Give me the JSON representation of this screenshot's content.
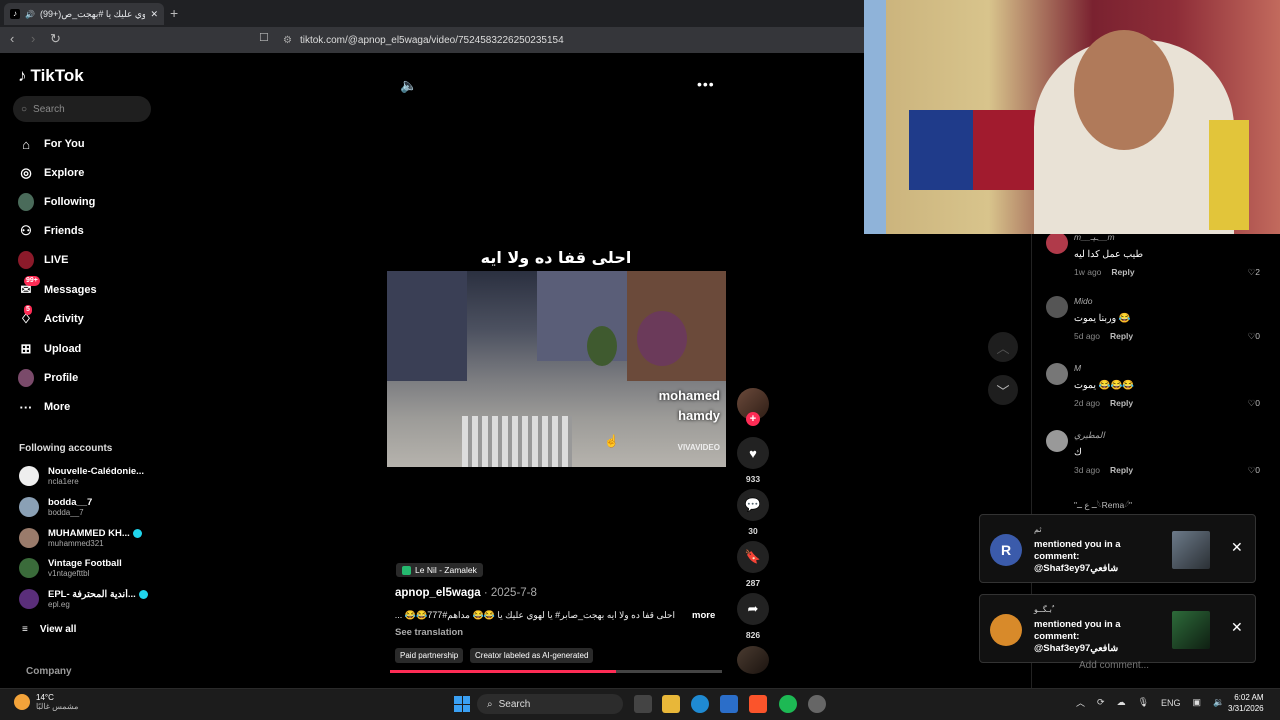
{
  "browser": {
    "tab_title": "(99+)يا لهوي عليك يا #بهجت_ص...",
    "url": "tiktok.com/@apnop_el5waga/video/7524583226250235154"
  },
  "sidebar": {
    "logo": "TikTok",
    "search_placeholder": "Search",
    "nav": [
      {
        "label": "For You",
        "icon": "home-icon"
      },
      {
        "label": "Explore",
        "icon": "compass-icon"
      },
      {
        "label": "Following",
        "icon": "following-avatar-icon"
      },
      {
        "label": "Friends",
        "icon": "friends-icon"
      },
      {
        "label": "LIVE",
        "icon": "live-icon"
      },
      {
        "label": "Messages",
        "icon": "messages-icon",
        "badge": "99+"
      },
      {
        "label": "Activity",
        "icon": "activity-icon",
        "badge": "5"
      },
      {
        "label": "Upload",
        "icon": "upload-icon"
      },
      {
        "label": "Profile",
        "icon": "profile-avatar-icon"
      },
      {
        "label": "More",
        "icon": "more-dots-icon"
      }
    ],
    "following_title": "Following accounts",
    "accounts": [
      {
        "name": "Nouvelle-Calédonie...",
        "user": "ncla1ere",
        "verified": false
      },
      {
        "name": "bodda__7",
        "user": "bodda__7",
        "verified": false
      },
      {
        "name": "MUHAMMED KH...",
        "user": "muhammed321",
        "verified": true
      },
      {
        "name": "Vintage Football",
        "user": "v1ntagefttbl",
        "verified": false
      },
      {
        "name": "EPL- أندية المحترفة...",
        "user": "epl.eg",
        "verified": true
      }
    ],
    "view_all": "View all",
    "company": "Company"
  },
  "video": {
    "overlay_title": "احلى قفا ده ولا ايه",
    "watermark_name_1": "mohamed",
    "watermark_name_2": "hamdy",
    "watermark_brand": "VIVAVIDEO",
    "likes": "933",
    "comments": "30",
    "saves": "287",
    "shares": "826",
    "location": "Le Nil - Zamalek",
    "author": "apnop_el5waga",
    "date": " · 2025-7-8",
    "caption": "احلى قفا ده ولا ايه بهجت_صابر# يا لهوي عليك يا 😂😂 مداهم#777😂😂 ...",
    "caption_more": "more",
    "see_translation": "See translation",
    "tags": [
      "Paid partnership",
      "Creator labeled as AI-generated"
    ],
    "progress": 0.68
  },
  "comments": [
    {
      "user": "m__ـيـ__m",
      "text": "طيب عمل كدا ليه",
      "time": "1w ago",
      "reply": "Reply",
      "likes": "2"
    },
    {
      "user": "Mido",
      "text": "وربنا يموت 😂",
      "time": "5d ago",
      "reply": "Reply",
      "likes": "0"
    },
    {
      "user": "M",
      "text": "يموت 😂😂😂",
      "time": "2d ago",
      "reply": "Reply",
      "likes": "0"
    },
    {
      "user": "المطيري",
      "text": "ك",
      "time": "3d ago",
      "reply": "Reply",
      "likes": "0"
    }
  ],
  "partial_comment_user": "\"ــ ع ــ𓆩Rema𓆪\"",
  "notifications": [
    {
      "user": "ثم",
      "text": "mentioned you in a comment: @Shaf3ey97شافعي",
      "avatar_letter": "R"
    },
    {
      "user": "بـگــو ٌ",
      "text": "mentioned you in a comment: @Shaf3ey97شافعي",
      "avatar_letter": ""
    }
  ],
  "add_comment_placeholder": "Add comment...",
  "taskbar": {
    "temp": "14°C",
    "weather": "مشمس غالبًا",
    "search": "Search",
    "lang": "ENG",
    "time": "6:02 AM",
    "date": "3/31/2026"
  },
  "colors": {
    "accent": "#fe2c55",
    "sidebar_bg": "#000000"
  }
}
